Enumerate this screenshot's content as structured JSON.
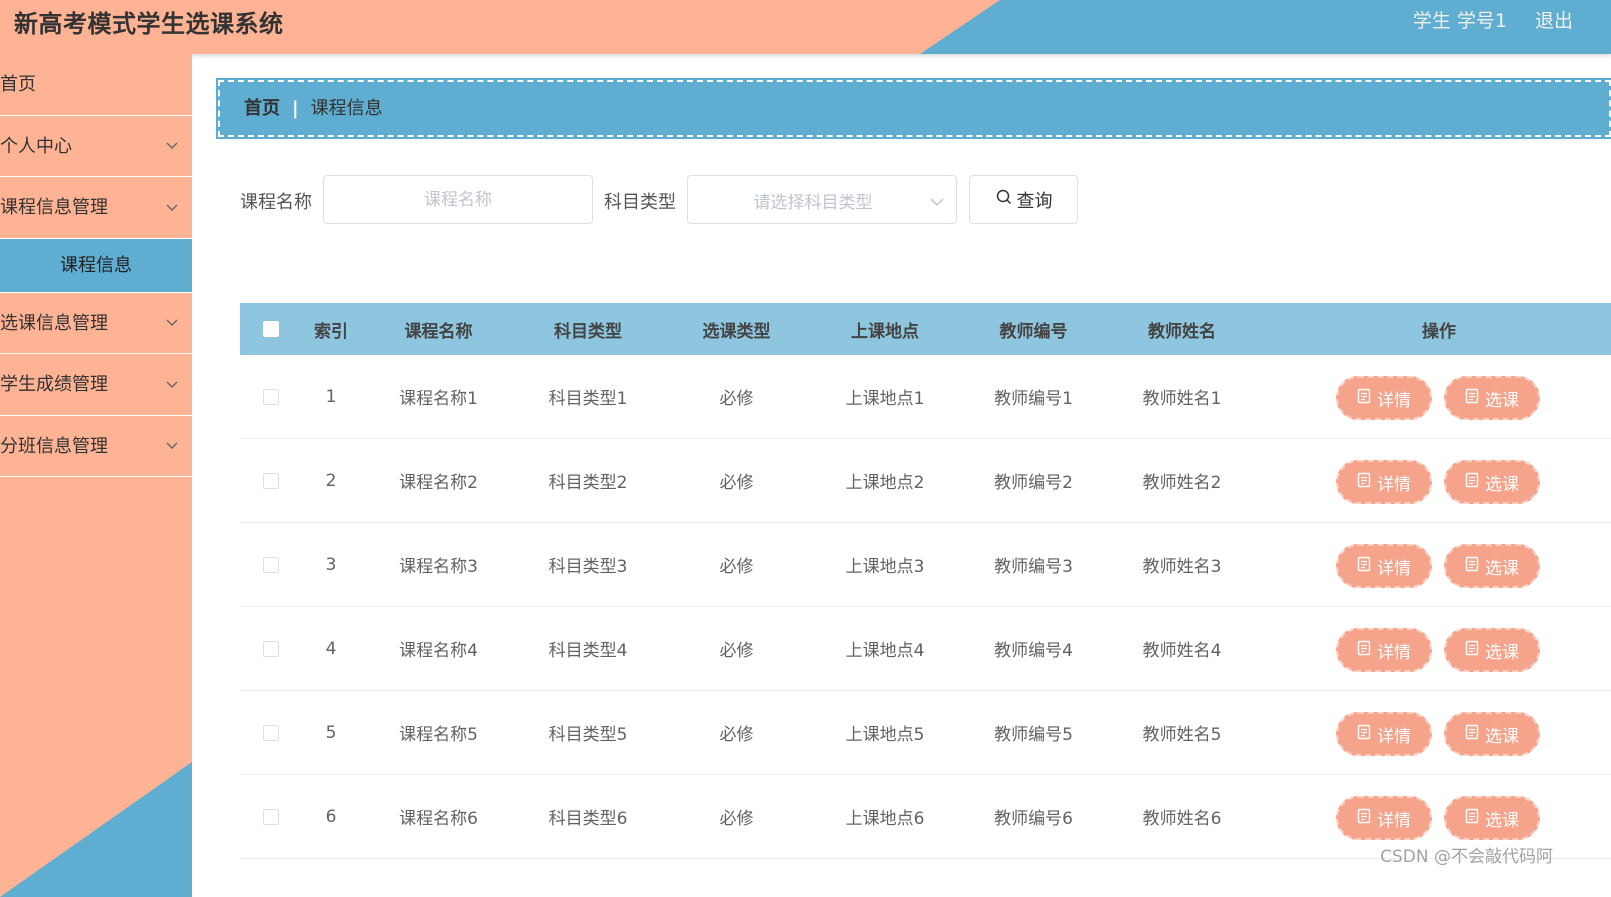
{
  "header": {
    "title": "新高考模式学生选课系统",
    "user": "学生 学号1",
    "logout": "退出"
  },
  "sidebar": {
    "items": [
      {
        "label": "首页",
        "has_chevron": false
      },
      {
        "label": "个人中心",
        "has_chevron": true
      },
      {
        "label": "课程信息管理",
        "has_chevron": true
      },
      {
        "label": "选课信息管理",
        "has_chevron": true
      },
      {
        "label": "学生成绩管理",
        "has_chevron": true
      },
      {
        "label": "分班信息管理",
        "has_chevron": true
      }
    ],
    "active_sub": "课程信息"
  },
  "breadcrumb": {
    "home": "首页",
    "current": "课程信息"
  },
  "search": {
    "course_label": "课程名称",
    "course_placeholder": "课程名称",
    "subject_label": "科目类型",
    "subject_placeholder": "请选择科目类型",
    "search_button": "查询"
  },
  "table": {
    "headers": [
      "索引",
      "课程名称",
      "科目类型",
      "选课类型",
      "上课地点",
      "教师编号",
      "教师姓名",
      "操作"
    ],
    "rows": [
      [
        "1",
        "课程名称1",
        "科目类型1",
        "必修",
        "上课地点1",
        "教师编号1",
        "教师姓名1"
      ],
      [
        "2",
        "课程名称2",
        "科目类型2",
        "必修",
        "上课地点2",
        "教师编号2",
        "教师姓名2"
      ],
      [
        "3",
        "课程名称3",
        "科目类型3",
        "必修",
        "上课地点3",
        "教师编号3",
        "教师姓名3"
      ],
      [
        "4",
        "课程名称4",
        "科目类型4",
        "必修",
        "上课地点4",
        "教师编号4",
        "教师姓名4"
      ],
      [
        "5",
        "课程名称5",
        "科目类型5",
        "必修",
        "上课地点5",
        "教师编号5",
        "教师姓名5"
      ],
      [
        "6",
        "课程名称6",
        "科目类型6",
        "必修",
        "上课地点6",
        "教师编号6",
        "教师姓名6"
      ]
    ],
    "detail_label": "详情",
    "select_label": "选课"
  },
  "watermark": "CSDN @不会敲代码阿",
  "colors": {
    "salmon": "#fdb394",
    "blue": "#5fadd0",
    "table_header": "#8ec6e0",
    "button": "#f5a38b"
  }
}
